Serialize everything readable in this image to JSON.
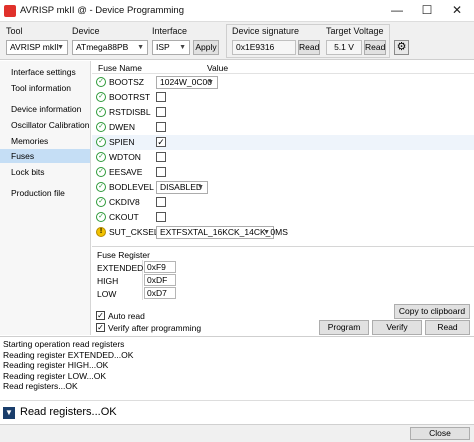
{
  "window": {
    "title": "AVRISP mkII @  - Device Programming",
    "minimize": "—",
    "maximize": "☐",
    "close": "✕"
  },
  "toolbar": {
    "tool_label": "Tool",
    "tool_value": "AVRISP mkII",
    "device_label": "Device",
    "device_value": "ATmega88PB",
    "interface_label": "Interface",
    "interface_value": "ISP",
    "apply_label": "Apply",
    "signature_label": "Device signature",
    "signature_value": "0x1E9316",
    "signature_read": "Read",
    "voltage_label": "Target Voltage",
    "voltage_value": "5.1 V",
    "voltage_read": "Read",
    "settings_icon": "gear-icon"
  },
  "nav": {
    "items": [
      {
        "label": "Interface settings"
      },
      {
        "label": "Tool information"
      },
      {
        "label": "Device information"
      },
      {
        "label": "Oscillator Calibration"
      },
      {
        "label": "Memories"
      },
      {
        "label": "Fuses"
      },
      {
        "label": "Lock bits"
      },
      {
        "label": "Production file"
      }
    ],
    "selected": "Fuses"
  },
  "fuses": {
    "col_name": "Fuse Name",
    "col_value": "Value",
    "rows": [
      {
        "name": "BOOTSZ",
        "type": "select",
        "value": "1024W_0C00",
        "status": "ok"
      },
      {
        "name": "BOOTRST",
        "type": "check",
        "checked": false,
        "status": "ok"
      },
      {
        "name": "RSTDISBL",
        "type": "check",
        "checked": false,
        "status": "ok"
      },
      {
        "name": "DWEN",
        "type": "check",
        "checked": false,
        "status": "ok"
      },
      {
        "name": "SPIEN",
        "type": "check",
        "checked": true,
        "status": "ok"
      },
      {
        "name": "WDTON",
        "type": "check",
        "checked": false,
        "status": "ok"
      },
      {
        "name": "EESAVE",
        "type": "check",
        "checked": false,
        "status": "ok"
      },
      {
        "name": "BODLEVEL",
        "type": "select",
        "value": "DISABLED",
        "status": "ok"
      },
      {
        "name": "CKDIV8",
        "type": "check",
        "checked": false,
        "status": "ok"
      },
      {
        "name": "CKOUT",
        "type": "check",
        "checked": false,
        "status": "ok"
      },
      {
        "name": "SUT_CKSEL",
        "type": "select",
        "value": "EXTFSXTAL_16KCK_14CK_0MS",
        "status": "warn"
      }
    ]
  },
  "registers": {
    "header": "Fuse Register",
    "items": [
      {
        "name": "EXTENDED",
        "value": "0xF9"
      },
      {
        "name": "HIGH",
        "value": "0xDF"
      },
      {
        "name": "LOW",
        "value": "0xD7"
      }
    ],
    "copy_label": "Copy to clipboard",
    "auto_read_label": "Auto read",
    "verify_label": "Verify after programming",
    "auto_read_checked": true,
    "verify_checked": true,
    "program_label": "Program",
    "verify_btn_label": "Verify",
    "read_label": "Read"
  },
  "log": {
    "lines": [
      "Starting operation read registers",
      "Reading register EXTENDED...OK",
      "Reading register HIGH...OK",
      "Reading register LOW...OK",
      "Read registers...OK"
    ]
  },
  "status": {
    "toggle_icon": "▼",
    "text": "Read registers...OK"
  },
  "footer": {
    "close_label": "Close"
  },
  "colors": {
    "selected_nav": "#c5def5",
    "ok_green": "#2e9a3a",
    "warn_yellow": "#f2c200",
    "status_toggle": "#1a3d6b"
  }
}
